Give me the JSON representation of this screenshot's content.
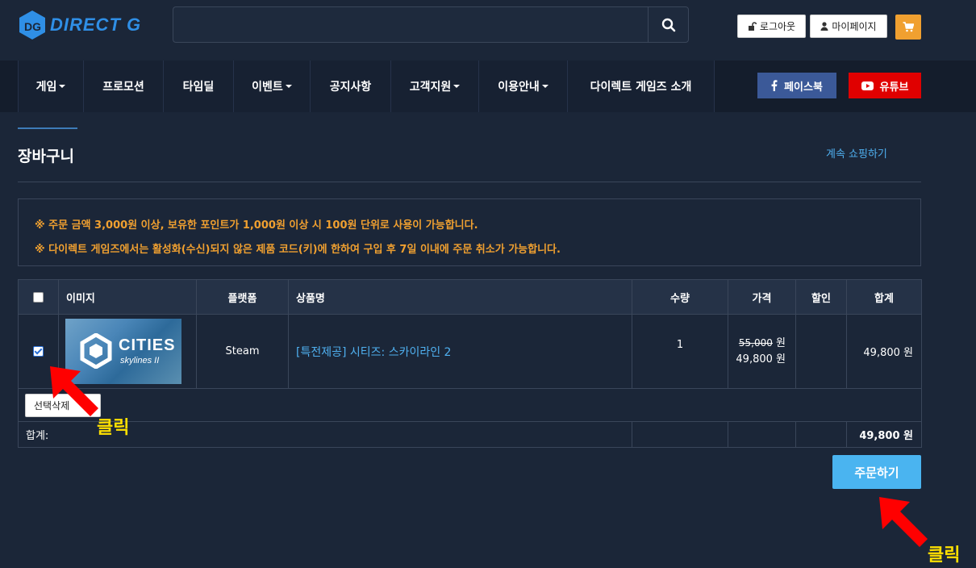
{
  "header": {
    "logo_text": "DIRECT G",
    "search_placeholder": "",
    "logout_label": "로그아웃",
    "mypage_label": "마이페이지",
    "icons": [
      "lock-icon",
      "user-icon",
      "search-icon",
      "cart-icon"
    ]
  },
  "nav": {
    "items": [
      {
        "label": "게임",
        "dropdown": true
      },
      {
        "label": "프로모션",
        "dropdown": false
      },
      {
        "label": "타임딜",
        "dropdown": false
      },
      {
        "label": "이벤트",
        "dropdown": true
      },
      {
        "label": "공지사항",
        "dropdown": false
      },
      {
        "label": "고객지원",
        "dropdown": true
      },
      {
        "label": "이용안내",
        "dropdown": true
      },
      {
        "label": "다이렉트 게임즈 소개",
        "dropdown": false
      }
    ],
    "facebook_label": "페이스북",
    "youtube_label": "유튜브"
  },
  "page": {
    "title": "장바구니",
    "continue_shopping": "계속 쇼핑하기"
  },
  "notice": {
    "line1": "※ 주문 금액 3,000원 이상, 보유한 포인트가 1,000원 이상 시 100원 단위로 사용이 가능합니다.",
    "line2": "※ 다이렉트 게임즈에서는 활성화(수신)되지 않은 제품 코드(키)에 한하여 구입 후 7일 이내에 주문 취소가 가능합니다."
  },
  "table": {
    "headers": {
      "image": "이미지",
      "platform": "플랫폼",
      "name": "상품명",
      "qty": "수량",
      "price": "가격",
      "discount": "할인",
      "total": "합계"
    },
    "rows": [
      {
        "checked": true,
        "thumb_title": "CITIES",
        "thumb_subtitle": "skylines II",
        "platform": "Steam",
        "name": "[특전제공] 시티즈: 스카이라인 2",
        "qty": "1",
        "old_price": "55,000",
        "old_price_unit": "원",
        "price": "49,800  원",
        "discount": "",
        "total": "49,800  원"
      }
    ],
    "delete_selected": "선택삭제",
    "sum_label": "합계:",
    "sum_value": "49,800 원"
  },
  "order_button": "주문하기",
  "annotations": {
    "click1": "클릭",
    "click2": "클릭"
  },
  "colors": {
    "background": "#1b2638",
    "accent_blue": "#4ab4f0",
    "notice_orange": "#f0a030",
    "annotation_red": "#ff0000",
    "annotation_yellow": "#ffe000"
  }
}
